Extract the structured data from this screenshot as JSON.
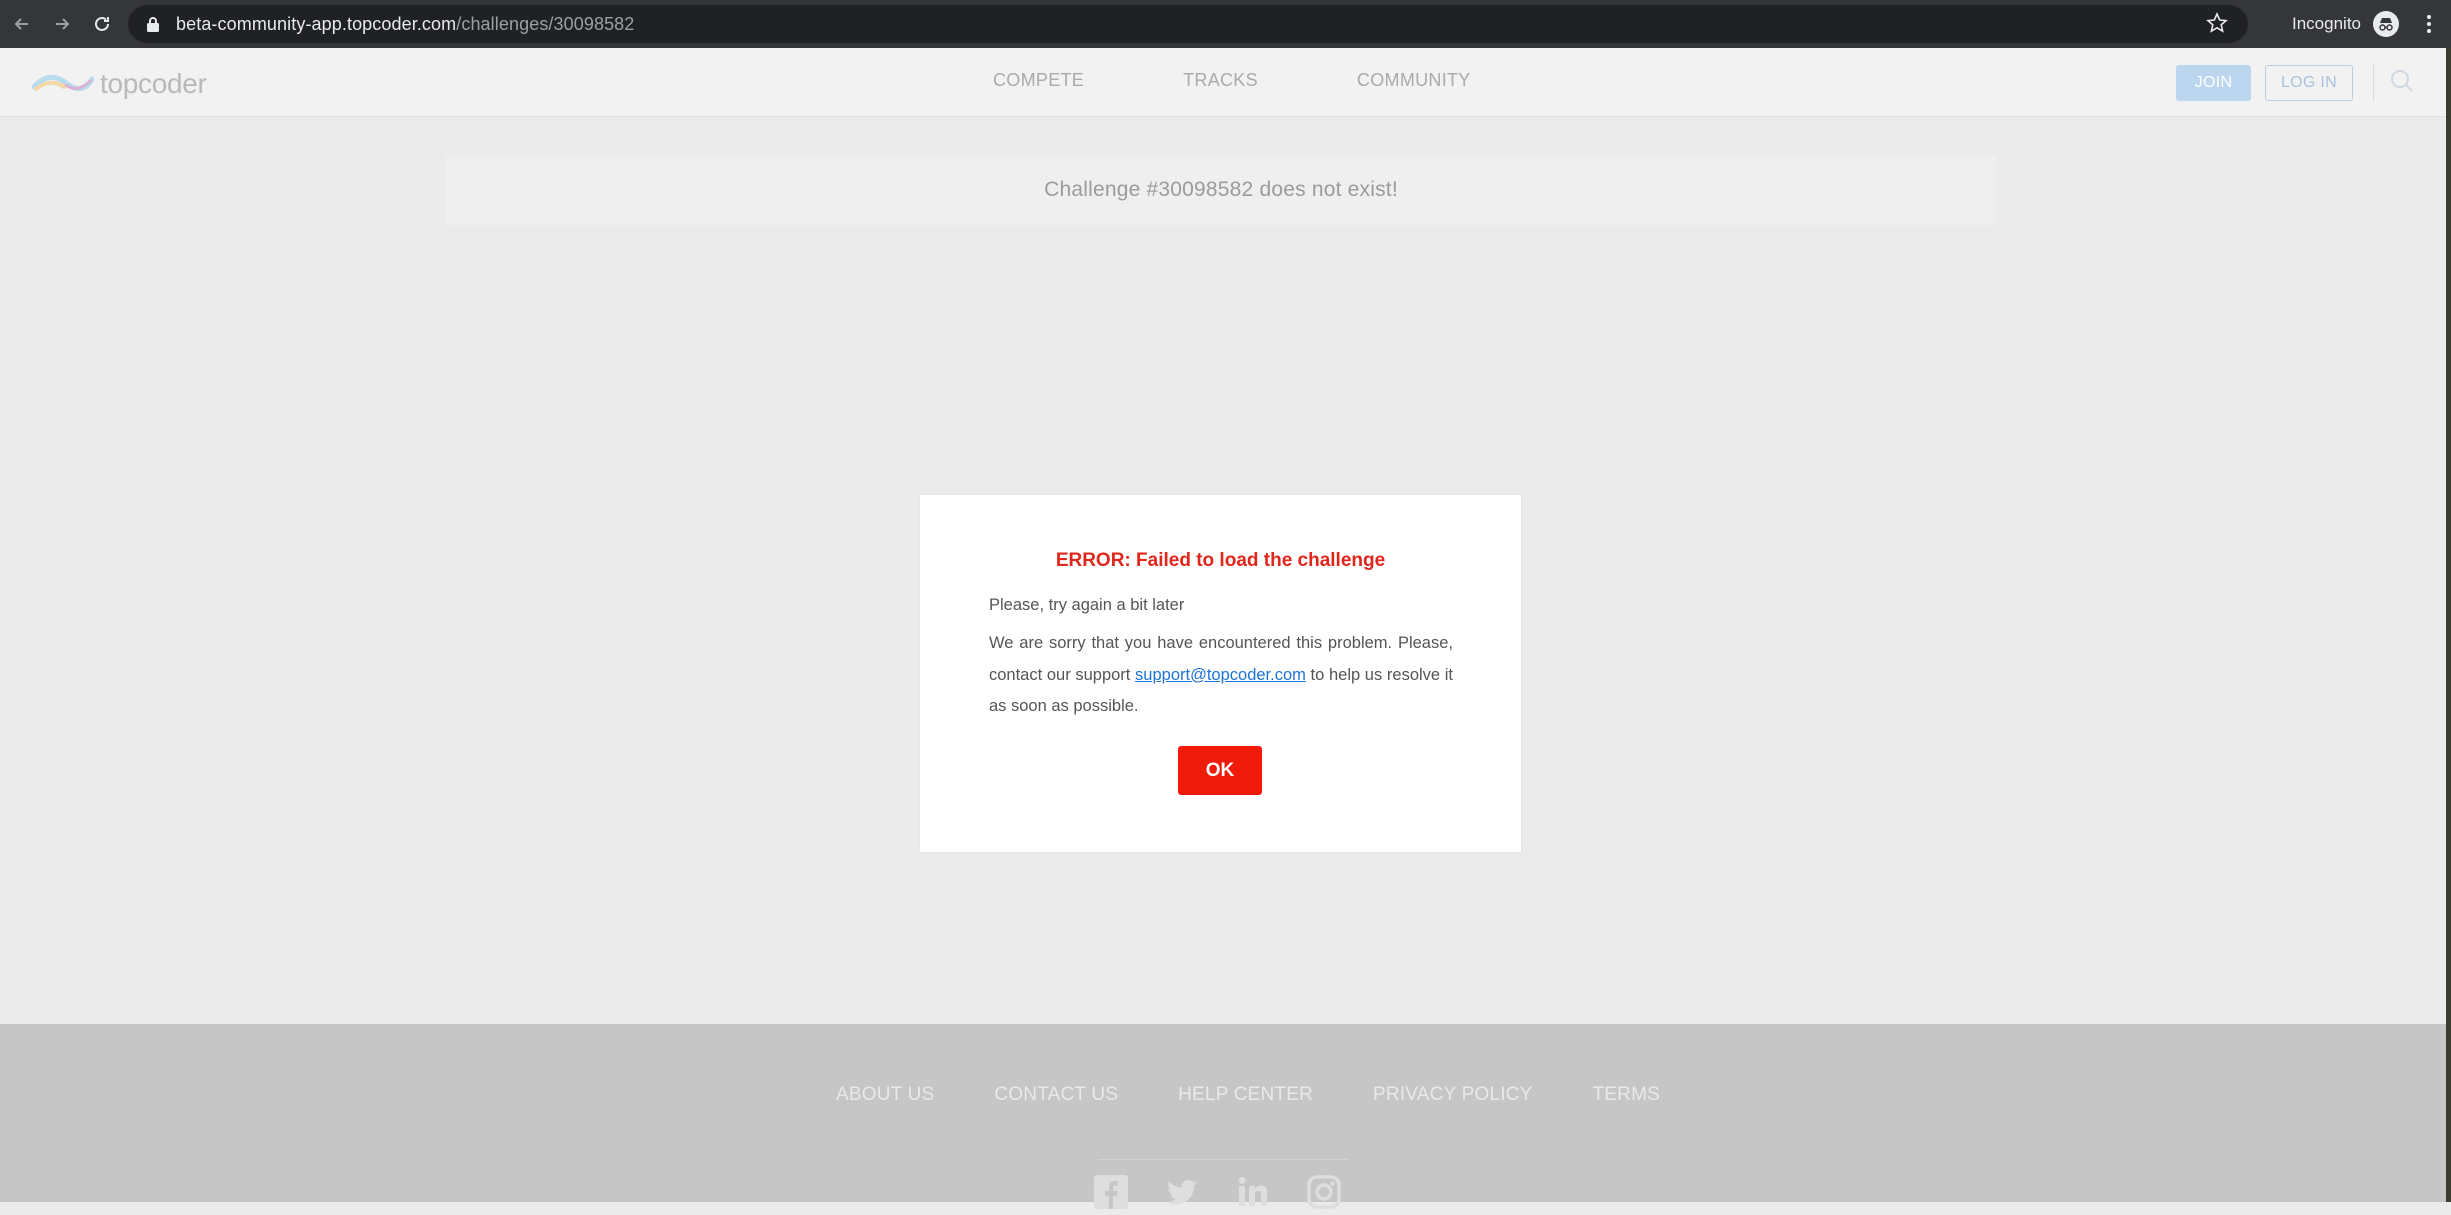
{
  "browser": {
    "url_host": "beta-community-app.topcoder.com",
    "url_path": "/challenges/30098582",
    "incognito_label": "Incognito"
  },
  "header": {
    "logo_text": "topcoder",
    "nav": [
      "COMPETE",
      "TRACKS",
      "COMMUNITY"
    ],
    "join_label": "JOIN",
    "login_label": "LOG IN"
  },
  "notice": {
    "text": "Challenge #30098582 does not exist!"
  },
  "modal": {
    "title": "ERROR: Failed to load the challenge",
    "line1": "Please, try again a bit later",
    "para_before": "We are sorry that you have encountered this problem. Please, contact our support ",
    "support_email": "support@topcoder.com",
    "para_after": " to help us resolve it as soon as possible.",
    "ok_label": "OK"
  },
  "footer": {
    "nav": [
      "ABOUT US",
      "CONTACT US",
      "HELP CENTER",
      "PRIVACY POLICY",
      "TERMS"
    ],
    "social": [
      "facebook-icon",
      "twitter-icon",
      "linkedin-icon",
      "instagram-icon"
    ]
  },
  "colors": {
    "error_red": "#e1261c",
    "ok_button": "#ef1a0a",
    "link_blue": "#1e74d6",
    "join_blue": "#bcd6ef"
  }
}
